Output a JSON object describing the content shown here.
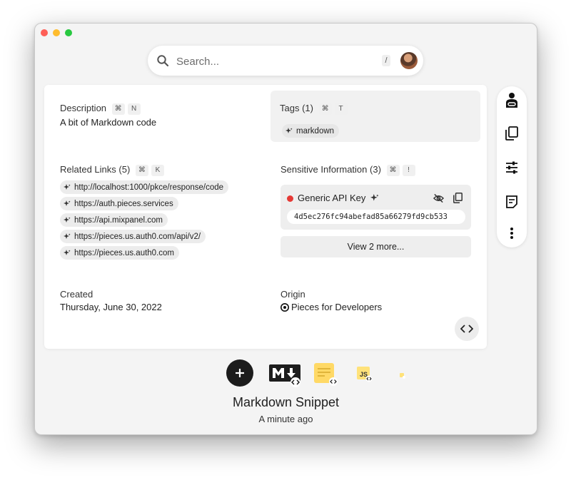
{
  "search": {
    "placeholder": "Search...",
    "shortcut": "/"
  },
  "description": {
    "title": "Description",
    "keys": [
      "⌘",
      "N"
    ],
    "text": "A bit of Markdown code"
  },
  "tags": {
    "title": "Tags (1)",
    "keys": [
      "⌘",
      "T"
    ],
    "items": [
      "markdown"
    ]
  },
  "related_links": {
    "title": "Related Links (5)",
    "keys": [
      "⌘",
      "K"
    ],
    "items": [
      "http://localhost:1000/pkce/response/code",
      "https://auth.pieces.services",
      "https://api.mixpanel.com",
      "https://pieces.us.auth0.com/api/v2/",
      "https://pieces.us.auth0.com"
    ]
  },
  "sensitive": {
    "title": "Sensitive Information (3)",
    "keys": [
      "⌘",
      "!"
    ],
    "item_name": "Generic API Key",
    "item_value": "4d5ec276fc94abefad85a66279fd9cb533",
    "view_more": "View 2 more...",
    "status_color": "#e53935"
  },
  "created": {
    "title": "Created",
    "value": "Thursday, June 30, 2022"
  },
  "origin": {
    "title": "Origin",
    "value": "Pieces for Developers"
  },
  "snippet": {
    "title": "Markdown Snippet",
    "subtitle": "A minute ago"
  },
  "toolbar_icons": [
    "user-link-icon",
    "copy-icon",
    "sliders-icon",
    "note-icon",
    "more-vertical-icon"
  ],
  "format_icons": [
    "markdown-icon",
    "note-icon",
    "javascript-icon",
    "small-format-icon"
  ]
}
